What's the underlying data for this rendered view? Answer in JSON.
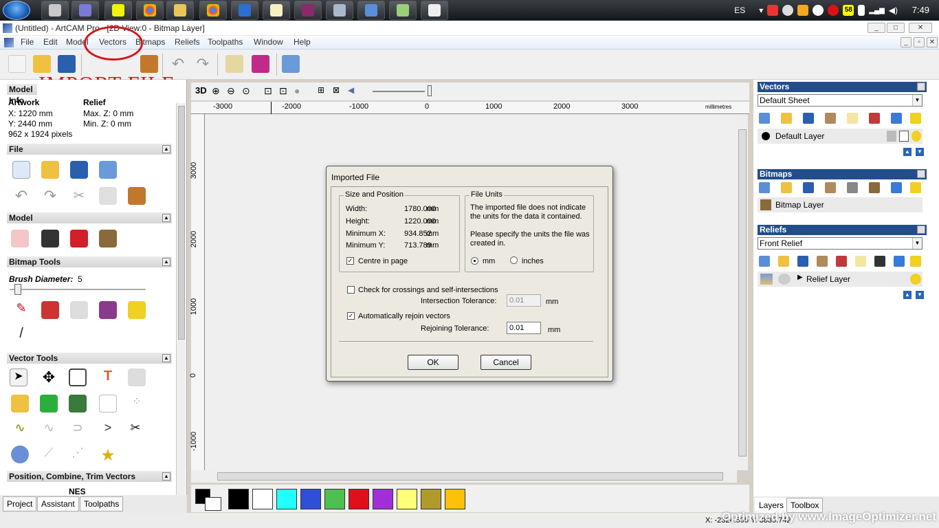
{
  "taskbar": {
    "lang": "ES",
    "badge": "58",
    "clock": "7:49"
  },
  "window": {
    "title": "(Untitled) - ArtCAM Pro - [2D View:0 - Bitmap Layer]",
    "minimize": "_",
    "maximize": "□",
    "close": "✕"
  },
  "menu": {
    "items": [
      "File",
      "Edit",
      "Model",
      "Vectors",
      "Bitmaps",
      "Reliefs",
      "Toolpaths",
      "Window",
      "Help"
    ]
  },
  "annotation": {
    "text": "IMPORT FILE"
  },
  "left": {
    "model_info_header": "Model Info",
    "artwork": {
      "title": "Artwork",
      "x": "X: 1220 mm",
      "y": "Y: 2440 mm",
      "pixels": "962 x 1924 pixels"
    },
    "relief": {
      "title": "Relief",
      "maxz": "Max. Z: 0 mm",
      "minz": "Min. Z: 0 mm"
    },
    "sections": {
      "file": "File",
      "model": "Model",
      "bitmap_tools": "Bitmap Tools",
      "vector_tools": "Vector Tools",
      "position": "Position, Combine, Trim Vectors"
    },
    "brush_label": "Brush Diameter:",
    "brush_value": "5",
    "nes_label": "NES",
    "tabs": [
      "Project",
      "Assistant",
      "Toolpaths"
    ]
  },
  "view": {
    "mode": "3D",
    "units": "millimetres",
    "h_ticks": [
      "-3000",
      "-2000",
      "-1000",
      "0",
      "1000",
      "2000",
      "3000"
    ],
    "v_ticks": [
      "3000",
      "2000",
      "1000",
      "0",
      "-1000"
    ]
  },
  "palette": {
    "colors": [
      "#000000",
      "#ffffff",
      "#22ffff",
      "#2f4fd8",
      "#4fbf4f",
      "#e0101a",
      "#a02fd8",
      "#ffff7a",
      "#b09a2a",
      "#ffc00a"
    ]
  },
  "right": {
    "vectors": {
      "header": "Vectors",
      "sheet": "Default Sheet",
      "layer": "Default Layer"
    },
    "bitmaps": {
      "header": "Bitmaps",
      "layer": "Bitmap Layer"
    },
    "reliefs": {
      "header": "Reliefs",
      "sheet": "Front Relief",
      "layer": "Relief Layer"
    },
    "tabs": [
      "Layers",
      "Toolbox"
    ]
  },
  "status": {
    "coords": "X: -2324.595 Y: 3835.742"
  },
  "watermark": "Optimized by www.ImageOptimizer.net",
  "dialog": {
    "title": "Imported File",
    "size_position": {
      "title": "Size and Position",
      "width_label": "Width:",
      "width": "1780.000",
      "height_label": "Height:",
      "height": "1220.000",
      "minx_label": "Minimum X:",
      "minx": "934.852",
      "miny_label": "Minimum Y:",
      "miny": "713.789",
      "unit": "mm",
      "centre": "Centre in page"
    },
    "file_units": {
      "title": "File Units",
      "line1": "The imported file does not indicate",
      "line2": "the units for the data it contained.",
      "line3": "Please specify the units the file was",
      "line4": "created in.",
      "opt_mm": "mm",
      "opt_in": "inches"
    },
    "crossings": "Check for crossings and self-intersections",
    "intersection_label": "Intersection Tolerance:",
    "intersection_value": "0.01",
    "rejoin": "Automatically rejoin vectors",
    "rejoin_label": "Rejoining Tolerance:",
    "rejoin_value": "0.01",
    "unit": "mm",
    "ok": "OK",
    "cancel": "Cancel"
  }
}
